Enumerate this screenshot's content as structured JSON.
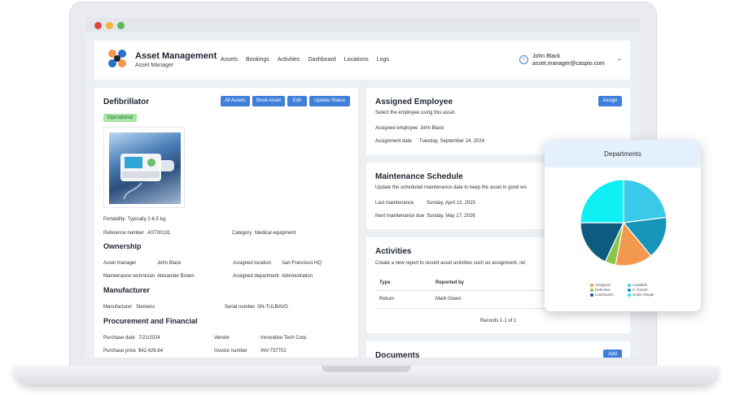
{
  "window": {
    "dot_colors": [
      "#e0443e",
      "#f0b43a",
      "#5cb85c"
    ]
  },
  "header": {
    "app_title": "Asset Management",
    "app_subtitle": "Asset Manager",
    "nav": [
      "Assets",
      "Bookings",
      "Activities",
      "Dashboard",
      "Locations",
      "Logs"
    ],
    "user_name": "John Black",
    "user_email": "asset.manager@caspio.com"
  },
  "asset": {
    "title": "Defibrillator",
    "status": "Operational",
    "buttons": [
      "All Assets",
      "Book Asset",
      "Edit",
      "Update Status"
    ],
    "portability": "Portability: Typically 2-6.5 kg.",
    "reference_label": "Reference number",
    "reference_value": "AST00131",
    "category_label": "Category",
    "category_value": "Medical equipment",
    "ownership_title": "Ownership",
    "asset_manager_label": "Asset manager",
    "asset_manager_value": "John Black",
    "assigned_location_label": "Assigned location",
    "assigned_location_value": "San Francisco HQ",
    "maint_tech_label": "Maintenance technician",
    "maint_tech_value": "Alexander Brown",
    "assigned_dept_label": "Assigned department",
    "assigned_dept_value": "Administration",
    "manufacturer_title": "Manufacturer",
    "manufacturer_label": "Manufacturer",
    "manufacturer_value": "Siemens",
    "serial_label": "Serial number",
    "serial_value": "SN-TULBAVG",
    "procurement_title": "Procurement and Financial",
    "purchase_date_label": "Purchase date",
    "purchase_date_value": "7/21/2024",
    "vendor_label": "Vendor",
    "vendor_value": "Innovative Tech Corp.",
    "purchase_price_label": "Purchase price",
    "purchase_price_value": "$42,426.64",
    "invoice_label": "Invoice number",
    "invoice_value": "INV-737702"
  },
  "assigned_employee": {
    "title": "Assigned Employee",
    "button": "Assign",
    "description": "Select the employee using this asset.",
    "employee_label": "Assigned employee",
    "employee_value": "John Black",
    "date_label": "Assignment date",
    "date_value": "Tuesday, September 24, 2024"
  },
  "maintenance": {
    "title": "Maintenance Schedule",
    "description": "Update the scheduled maintenance date to keep the asset in good wo",
    "last_label": "Last maintenance",
    "last_value": "Sunday, April 13, 2025",
    "next_label": "Next maintenance due",
    "next_value": "Sunday, May 17, 2026"
  },
  "activities": {
    "title": "Activities",
    "description": "Create a new report to record asset activities such as assignment, ret",
    "columns": [
      "Type",
      "Reported by"
    ],
    "rows": [
      [
        "Return",
        "Mark Green"
      ]
    ],
    "records": "Records 1-1 of 1"
  },
  "documents": {
    "title": "Documents",
    "button": "Add"
  },
  "chart_data": {
    "type": "pie",
    "title": "Departments",
    "legend_position": "bottom",
    "slices": [
      {
        "name": "Available",
        "value": 23,
        "color": "#3ac9e8"
      },
      {
        "name": "Under Repair",
        "value": 16,
        "color": "#1795b8"
      },
      {
        "name": "Assigned",
        "value": 14,
        "color": "#f3994f"
      },
      {
        "name": "Defective",
        "value": 4,
        "color": "#8bc44a"
      },
      {
        "name": "Lost/Stolen",
        "value": 18,
        "color": "#0d5c80"
      },
      {
        "name": "In Transit",
        "value": 25,
        "color": "#0ff0f4"
      }
    ],
    "legend": [
      {
        "name": "Assigned",
        "color": "#f3994f"
      },
      {
        "name": "Available",
        "color": "#3ac9e8"
      },
      {
        "name": "Defective",
        "color": "#8bc44a"
      },
      {
        "name": "In Transit",
        "color": "#1795b8"
      },
      {
        "name": "Lost/Stolen",
        "color": "#0d5c80"
      },
      {
        "name": "Under Repair",
        "color": "#0ff0f4"
      }
    ]
  }
}
